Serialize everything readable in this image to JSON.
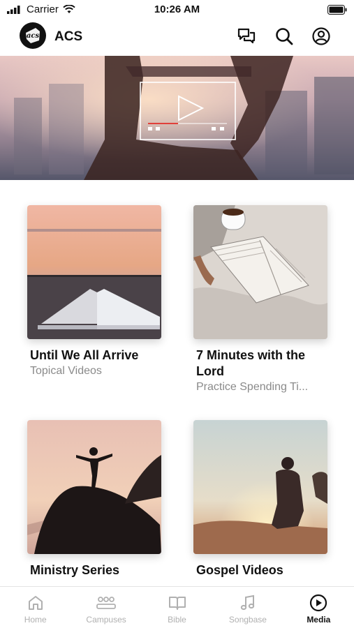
{
  "status": {
    "carrier": "Carrier",
    "time": "10:26 AM"
  },
  "header": {
    "title": "ACS",
    "logo_text": "acs"
  },
  "cards": [
    {
      "title": "Until We All Arrive",
      "subtitle": "Topical Videos"
    },
    {
      "title": "7 Minutes with the Lord",
      "subtitle": "Practice Spending Ti..."
    },
    {
      "title": "Ministry Series",
      "subtitle": ""
    },
    {
      "title": "Gospel Videos",
      "subtitle": ""
    }
  ],
  "tabs": [
    {
      "label": "Home",
      "icon": "home-icon"
    },
    {
      "label": "Campuses",
      "icon": "people-icon"
    },
    {
      "label": "Bible",
      "icon": "book-icon"
    },
    {
      "label": "Songbase",
      "icon": "music-note-icon"
    },
    {
      "label": "Media",
      "icon": "play-circle-icon",
      "active": true
    }
  ],
  "colors": {
    "active_tab": "#111111",
    "inactive_tab": "#b0b0b0",
    "subtitle": "#8a8a8a"
  }
}
